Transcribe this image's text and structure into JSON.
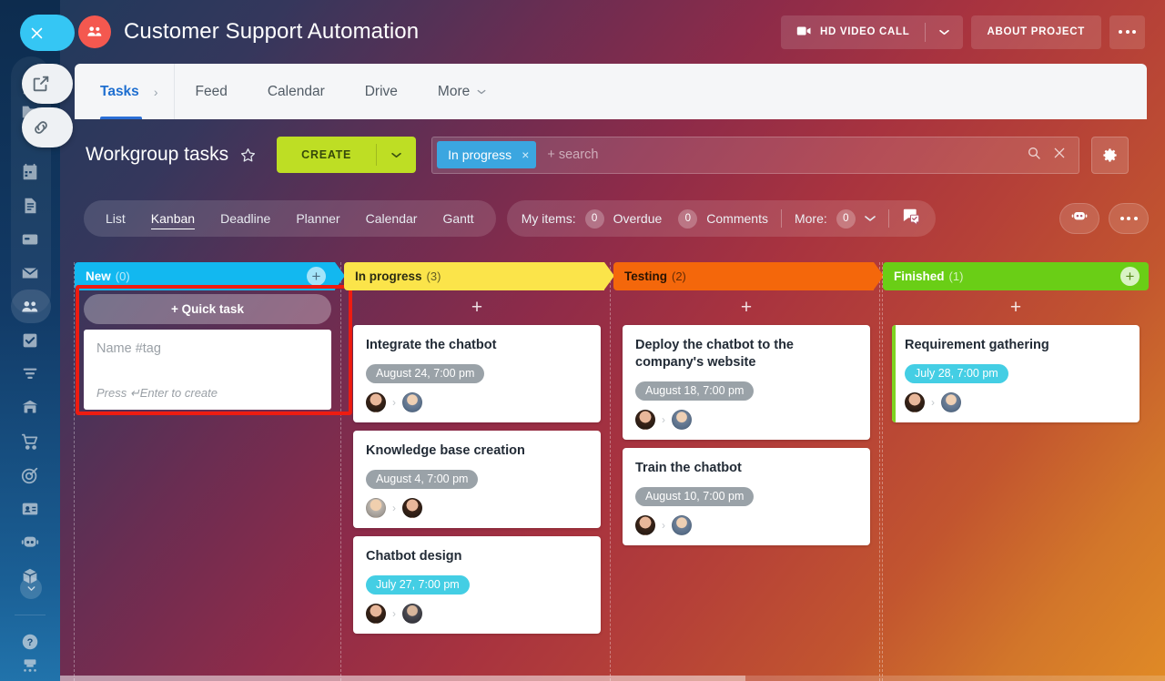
{
  "sidebar": {
    "close_icon": "close-icon",
    "items": [
      {
        "icon": "external-link-icon",
        "name": "sidebar-item-external-link"
      },
      {
        "icon": "chain-link-icon",
        "name": "sidebar-item-link"
      },
      {
        "icon": "calendar-icon",
        "name": "sidebar-item-calendar"
      },
      {
        "icon": "document-icon",
        "name": "sidebar-item-documents"
      },
      {
        "icon": "drawer-icon",
        "name": "sidebar-item-drive"
      },
      {
        "icon": "mail-icon",
        "name": "sidebar-item-mail"
      },
      {
        "icon": "group-icon",
        "name": "sidebar-item-workgroups"
      },
      {
        "icon": "checkbox-icon",
        "name": "sidebar-item-tasks"
      },
      {
        "icon": "funnel-icon",
        "name": "sidebar-item-crm"
      },
      {
        "icon": "bank-icon",
        "name": "sidebar-item-company"
      },
      {
        "icon": "cart-icon",
        "name": "sidebar-item-shop"
      },
      {
        "icon": "target-icon",
        "name": "sidebar-item-marketing"
      },
      {
        "icon": "contact-card-icon",
        "name": "sidebar-item-contact-center"
      },
      {
        "icon": "robot-icon",
        "name": "sidebar-item-automation"
      },
      {
        "icon": "box-icon",
        "name": "sidebar-item-inventory"
      },
      {
        "icon": "chevron-down-icon",
        "name": "sidebar-item-more"
      },
      {
        "icon": "help-icon",
        "name": "sidebar-item-help"
      },
      {
        "icon": "device-icon",
        "name": "sidebar-item-devices"
      }
    ]
  },
  "header": {
    "logo_icon": "group-avatar-icon",
    "title": "Customer Support Automation",
    "video_call_label": "HD VIDEO CALL",
    "video_call_icon": "video-camera-icon",
    "video_caret_icon": "chevron-down-icon",
    "about_label": "ABOUT PROJECT",
    "more_icon": "ellipsis-icon"
  },
  "tabs": {
    "main": {
      "label": "Tasks",
      "chevron": "›"
    },
    "items": [
      {
        "label": "Feed"
      },
      {
        "label": "Calendar"
      },
      {
        "label": "Drive"
      },
      {
        "label": "More",
        "caret": "⌄"
      }
    ]
  },
  "toolbar": {
    "page_title": "Workgroup tasks",
    "star_icon": "star-outline-icon",
    "create_label": "CREATE",
    "create_caret_icon": "chevron-down-icon",
    "filter_chip": "In progress",
    "filter_chip_close": "×",
    "search_placeholder": "+ search",
    "search_icon": "magnifier-icon",
    "clear_icon": "close-icon",
    "settings_icon": "gear-icon"
  },
  "viewbar": {
    "views": [
      {
        "label": "List",
        "active": false
      },
      {
        "label": "Kanban",
        "active": true
      },
      {
        "label": "Deadline",
        "active": false
      },
      {
        "label": "Planner",
        "active": false
      },
      {
        "label": "Calendar",
        "active": false
      },
      {
        "label": "Gantt",
        "active": false
      }
    ],
    "my_items_label": "My items:",
    "overdue_count": "0",
    "overdue_label": "Overdue",
    "comments_count": "0",
    "comments_label": "Comments",
    "more_label": "More:",
    "more_count": "0",
    "more_caret": "⌄",
    "chat_icon": "comment-check-icon",
    "robot_icon": "robot-icon",
    "dots_icon": "ellipsis-icon"
  },
  "board": {
    "add_card_plus": "+",
    "quick_task": {
      "button_label": "+ Quick task",
      "input_placeholder": "Name #tag",
      "hint": "Press ↵Enter to create"
    },
    "columns": [
      {
        "name": "New",
        "count": "(0)",
        "color": "#12b8f0",
        "add_icon": "plus-circle-icon",
        "cards": []
      },
      {
        "name": "In progress",
        "count": "(3)",
        "color": "#fbe44a",
        "cards": [
          {
            "title": "Integrate the chatbot",
            "date": "August 24, 7:00 pm",
            "date_style": "gray"
          },
          {
            "title": "Knowledge base creation",
            "date": "August 4, 7:00 pm",
            "date_style": "gray"
          },
          {
            "title": "Chatbot design",
            "date": "July 27, 7:00 pm",
            "date_style": "cyan"
          }
        ]
      },
      {
        "name": "Testing",
        "count": "(2)",
        "color": "#f4670b",
        "cards": [
          {
            "title": "Deploy the chatbot to the company's website",
            "date": "August 18, 7:00 pm",
            "date_style": "gray"
          },
          {
            "title": "Train the chatbot",
            "date": "August 10, 7:00 pm",
            "date_style": "gray"
          }
        ]
      },
      {
        "name": "Finished",
        "count": "(1)",
        "color": "#6ace16",
        "add_icon": "plus-circle-icon",
        "cards": [
          {
            "title": "Requirement gathering",
            "date": "July 28, 7:00 pm",
            "date_style": "cyan"
          }
        ]
      }
    ]
  }
}
